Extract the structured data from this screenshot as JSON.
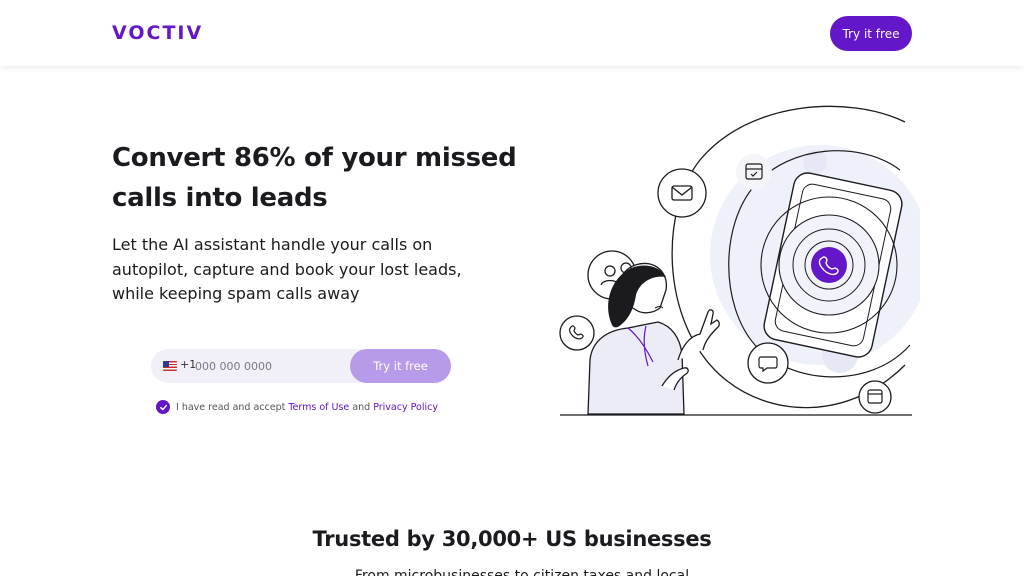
{
  "header": {
    "logo": "VOCTIV",
    "cta_label": "Try it free"
  },
  "hero": {
    "title_line1": "Convert 86% of your missed",
    "title_line2": "calls into leads",
    "subtitle": "Let the AI assistant handle your calls on autopilot, capture and book your lost leads, while keeping spam calls away"
  },
  "form": {
    "country_flag": "us-flag-icon",
    "dial_code": "+1",
    "phone_placeholder": "000 000 0000",
    "phone_value": "",
    "submit_label": "Try it free"
  },
  "consent": {
    "prefix": "I have read and accept ",
    "terms_link": "Terms of Use",
    "conjunction": " and ",
    "privacy_link": "Privacy Policy",
    "checked": true
  },
  "illustration": {
    "icons": [
      "envelope-icon",
      "calendar-icon",
      "user-icon",
      "phone-icon",
      "chat-icon",
      "calendar-icon",
      "phone-icon"
    ]
  },
  "trust": {
    "heading": "Trusted by 30,000+ US businesses",
    "subtext": "From microbusinesses to citizen taxes and local"
  },
  "colors": {
    "brand": "#6416c9",
    "button_disabled": "#b79ae9",
    "input_bg": "#f1eff7",
    "text": "#1b1b1f"
  }
}
